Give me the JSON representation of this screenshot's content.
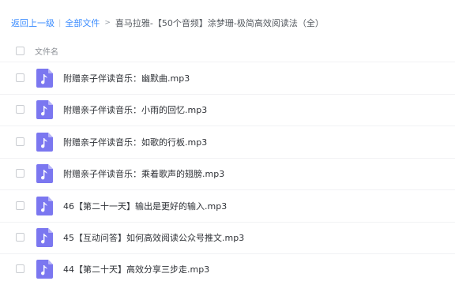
{
  "breadcrumb": {
    "back": "返回上一级",
    "separator": "|",
    "all_files": "全部文件",
    "arrow": ">",
    "current": "喜马拉雅-【50个音频】涂梦珊-极简高效阅读法（全）"
  },
  "list_header": {
    "name_column": "文件名"
  },
  "files": [
    {
      "name": "附赠亲子伴读音乐：幽默曲.mp3",
      "icon": "audio-file-icon"
    },
    {
      "name": "附赠亲子伴读音乐：小雨的回忆.mp3",
      "icon": "audio-file-icon"
    },
    {
      "name": "附赠亲子伴读音乐：如歌的行板.mp3",
      "icon": "audio-file-icon"
    },
    {
      "name": "附赠亲子伴读音乐：乘着歌声的翅膀.mp3",
      "icon": "audio-file-icon"
    },
    {
      "name": "46【第二十一天】输出是更好的输入.mp3",
      "icon": "audio-file-icon"
    },
    {
      "name": "45【互动问答】如何高效阅读公众号推文.mp3",
      "icon": "audio-file-icon"
    },
    {
      "name": "44【第二十天】高效分享三步走.mp3",
      "icon": "audio-file-icon"
    }
  ],
  "colors": {
    "link": "#3b8cff",
    "icon_bg": "#7b77f0",
    "icon_fold": "#b7b4f8",
    "text": "#2f3237"
  }
}
